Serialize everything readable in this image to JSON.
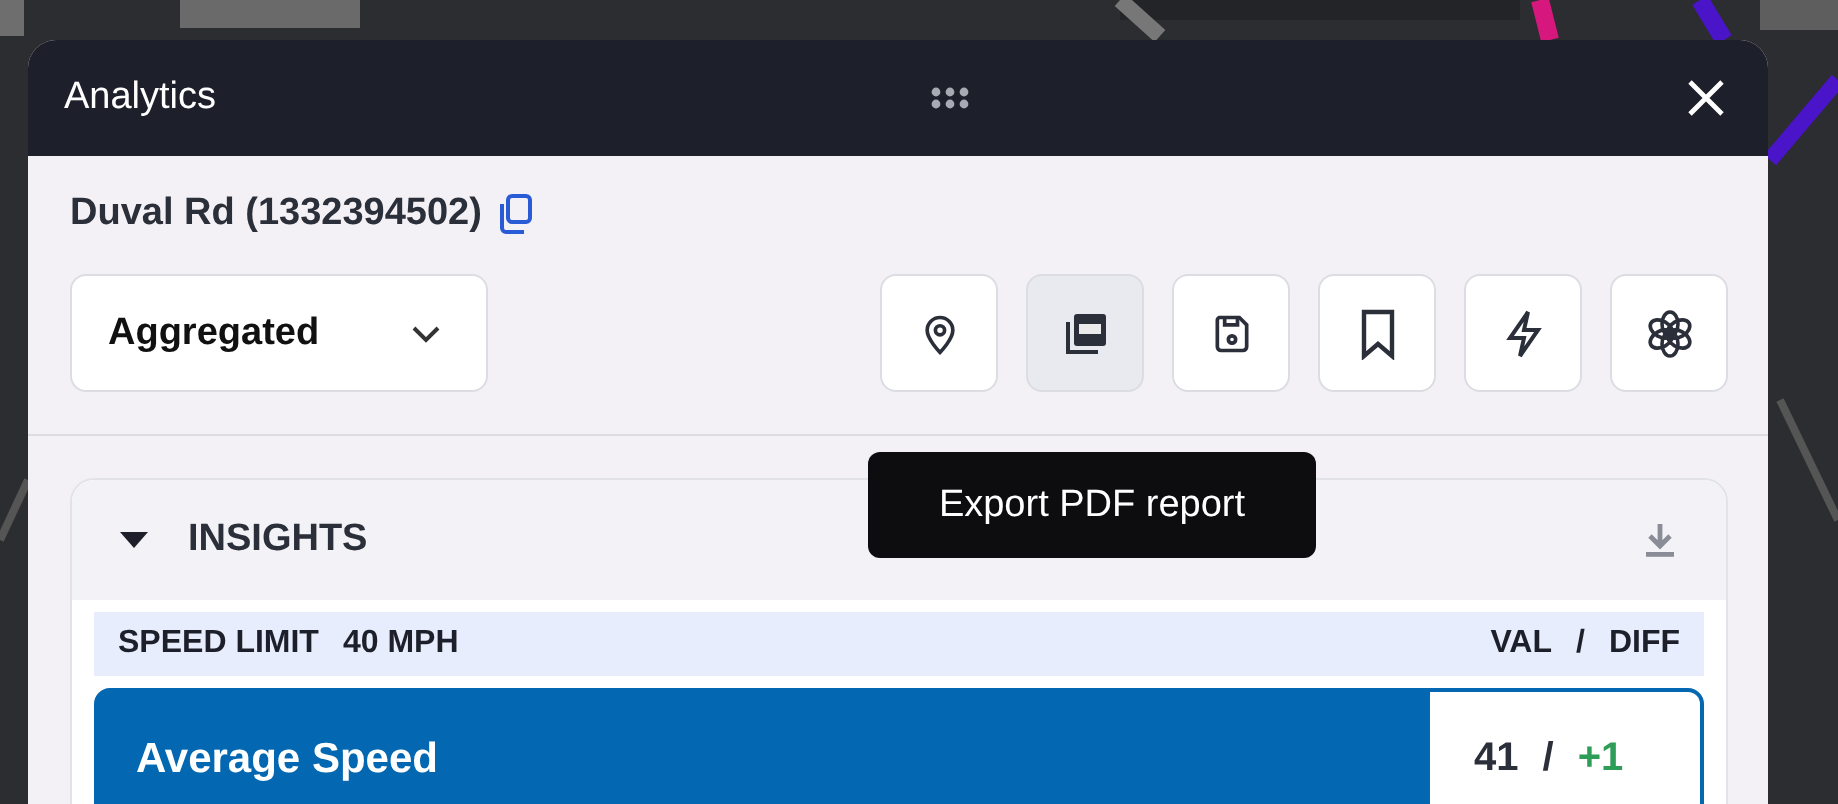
{
  "window": {
    "title": "Analytics"
  },
  "road": {
    "title": "Duval Rd (1332394502)"
  },
  "view_select": {
    "value": "Aggregated"
  },
  "toolbar": [
    {
      "kind": "pin",
      "selected": false
    },
    {
      "kind": "pdf",
      "selected": true
    },
    {
      "kind": "save",
      "selected": false
    },
    {
      "kind": "bookmark",
      "selected": false
    },
    {
      "kind": "bolt",
      "selected": false
    },
    {
      "kind": "ai",
      "selected": false
    }
  ],
  "tooltip": "Export PDF report",
  "insights": {
    "title": "INSIGHTS",
    "expanded": true,
    "speed_limit": {
      "label": "SPEED LIMIT",
      "value": "40 MPH"
    },
    "columns": [
      "VAL",
      "/",
      "DIFF"
    ],
    "metrics": [
      {
        "name": "Average Speed",
        "value": "41",
        "separator": "/",
        "diff": "+1"
      }
    ]
  }
}
